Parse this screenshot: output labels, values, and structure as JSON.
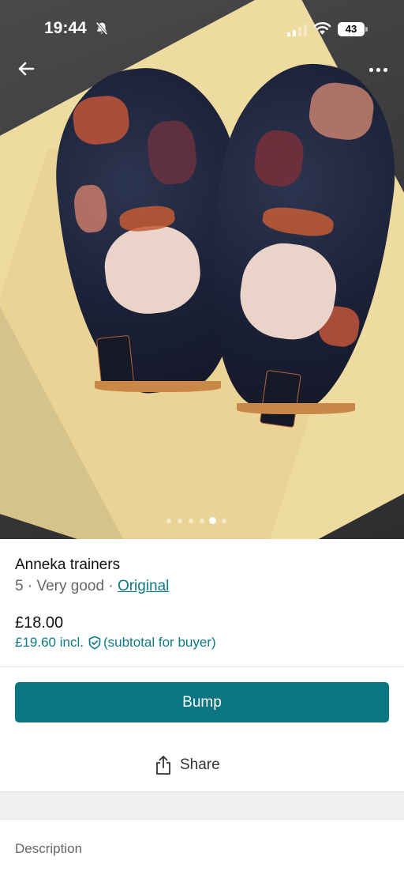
{
  "status_bar": {
    "time": "19:44",
    "battery": "43"
  },
  "gallery": {
    "photo_description": "Anneka trainers on yellow dust bag",
    "page_count": 5,
    "active_page": 4
  },
  "item": {
    "title": "Anneka trainers",
    "size": "5",
    "separator": " · ",
    "condition": "Very good",
    "original_link": "Original",
    "price": "£18.00",
    "price_incl": "£19.60 incl.",
    "subtotal_note": "(subtotal for buyer)"
  },
  "actions": {
    "bump_label": "Bump",
    "share_label": "Share"
  },
  "description": {
    "heading": "Description"
  },
  "colors": {
    "accent": "#0b7581",
    "link": "#0c7a85"
  }
}
